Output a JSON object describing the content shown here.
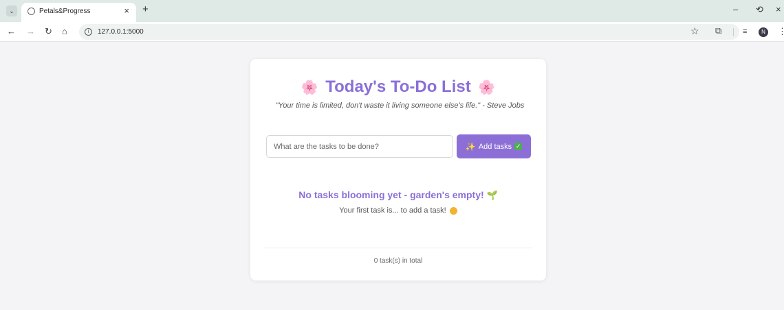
{
  "browser": {
    "tab_title": "Petals&Progress",
    "url": "127.0.0.1:5000",
    "profile_initial": "N"
  },
  "page": {
    "title": "Today's To-Do List",
    "quote": "\"Your time is limited, don't waste it living someone else's life.\" - Steve Jobs",
    "input_placeholder": "What are the tasks to be done?",
    "input_value": "",
    "add_button_label": "Add tasks",
    "empty_title": "No tasks blooming yet - garden's empty!",
    "empty_subtitle": "Your first task is... to add a task!",
    "total_text": "0 task(s) in total"
  },
  "colors": {
    "accent": "#8a6fd8",
    "button": "#8c6fd6",
    "page_bg": "#f4f4f6"
  },
  "icons": [
    "flower-icon",
    "sparkle-icon",
    "check-icon",
    "seedling-icon",
    "smile-icon"
  ]
}
